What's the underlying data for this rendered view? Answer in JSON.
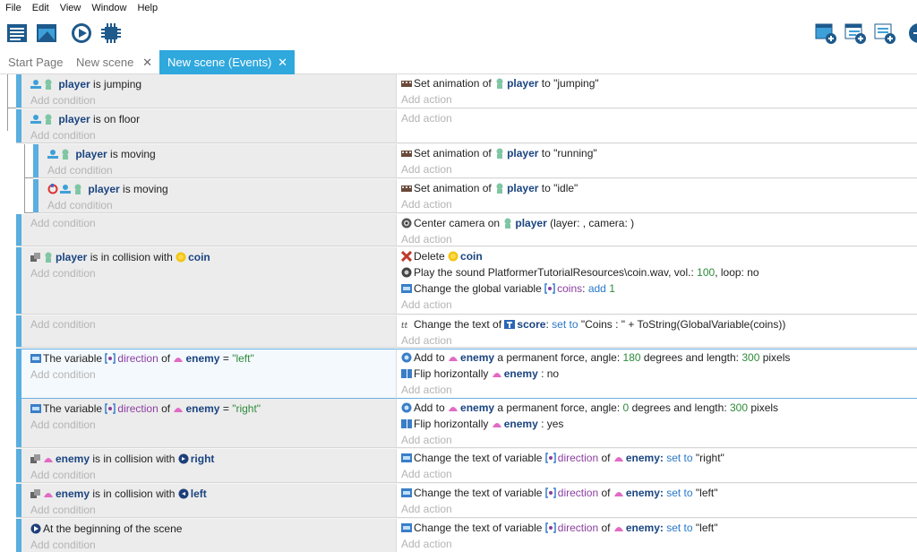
{
  "menu": [
    "File",
    "Edit",
    "View",
    "Window",
    "Help"
  ],
  "toolbar_left": [
    "project-manager-icon",
    "scene-editor-icon",
    "preview-play-icon",
    "debugger-chip-icon"
  ],
  "toolbar_right": [
    "add-event-icon",
    "add-subevent-icon",
    "add-comment-icon",
    "add-more-icon"
  ],
  "tabs": [
    {
      "label": "Start Page"
    },
    {
      "label": "New scene",
      "close": "✕"
    },
    {
      "label": "New scene (Events)",
      "close": "✕"
    }
  ],
  "add_condition": "Add condition",
  "add_action": "Add action",
  "ev1": {
    "cond": {
      "obj": "player",
      "text": "is jumping"
    },
    "act": {
      "pre": "Set animation of",
      "obj": "player",
      "post": "to \"jumping\""
    }
  },
  "ev2": {
    "cond": {
      "obj": "player",
      "text": "is on floor"
    }
  },
  "ev3": {
    "cond": {
      "obj": "player",
      "text": "is moving"
    },
    "act": {
      "pre": "Set animation of",
      "obj": "player",
      "post": "to \"running\""
    }
  },
  "ev4": {
    "cond": {
      "obj": "player",
      "text": "is moving"
    },
    "act": {
      "pre": "Set animation of",
      "obj": "player",
      "post": "to \"idle\""
    }
  },
  "ev5": {
    "act": {
      "pre": "Center camera on",
      "obj": "player",
      "post": "(layer: , camera: )"
    }
  },
  "ev6": {
    "cond": {
      "obj": "player",
      "text": "is in collision with",
      "obj2": "coin"
    },
    "act1": {
      "pre": "Delete",
      "obj": "coin"
    },
    "act2": {
      "pre": "Play the sound",
      "file": "PlatformerTutorialResources\\coin.wav, vol.:",
      "vol": "100",
      "post": ", loop:",
      "loop": "no"
    },
    "act3": {
      "pre": "Change the global variable",
      "var": "coins",
      "op": "add",
      "val": "1"
    }
  },
  "ev7": {
    "act": {
      "pre": "Change the text of",
      "obj": "score",
      "op": "set to",
      "post": "\"Coins : \" + ToString(GlobalVariable(coins))"
    }
  },
  "ev8": {
    "cond": {
      "pre": "The variable",
      "var": "direction",
      "of": "of",
      "obj": "enemy",
      "eq": "=",
      "val": "\"left\""
    },
    "act1": {
      "pre": "Add to",
      "obj": "enemy",
      "mid": "a permanent force, angle:",
      "angle": "180",
      "mid2": "degrees and length:",
      "len": "300",
      "post": "pixels"
    },
    "act2": {
      "pre": "Flip horizontally",
      "obj": "enemy",
      "post": ": no"
    }
  },
  "ev9": {
    "cond": {
      "pre": "The variable",
      "var": "direction",
      "of": "of",
      "obj": "enemy",
      "eq": "=",
      "val": "\"right\""
    },
    "act1": {
      "pre": "Add to",
      "obj": "enemy",
      "mid": "a permanent force, angle:",
      "angle": "0",
      "mid2": "degrees and length:",
      "len": "300",
      "post": "pixels"
    },
    "act2": {
      "pre": "Flip horizontally",
      "obj": "enemy",
      "post": ": yes"
    }
  },
  "ev10": {
    "cond": {
      "obj": "enemy",
      "text": "is in collision with",
      "obj2": "right"
    },
    "act": {
      "pre": "Change the text of variable",
      "var": "direction",
      "of": "of",
      "obj": "enemy:",
      "op": "set to",
      "post": "\"right\""
    }
  },
  "ev11": {
    "cond": {
      "obj": "enemy",
      "text": "is in collision with",
      "obj2": "left"
    },
    "act": {
      "pre": "Change the text of variable",
      "var": "direction",
      "of": "of",
      "obj": "enemy:",
      "op": "set to",
      "post": "\"left\""
    }
  },
  "ev12": {
    "cond": {
      "text": "At the beginning of the scene"
    },
    "act": {
      "pre": "Change the text of variable",
      "var": "direction",
      "of": "of",
      "obj": "enemy:",
      "op": "set to",
      "post": "\"left\""
    }
  }
}
